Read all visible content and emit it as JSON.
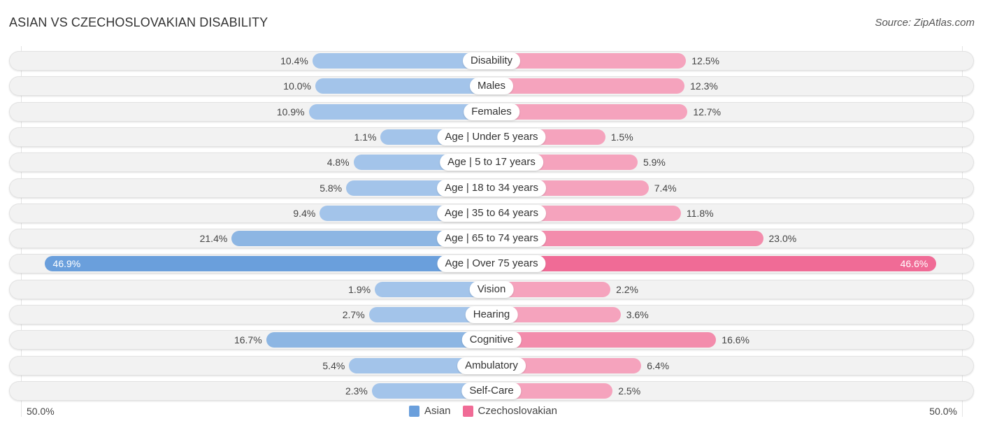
{
  "header": {
    "title": "ASIAN VS CZECHOSLOVAKIAN DISABILITY",
    "source": "Source: ZipAtlas.com"
  },
  "colors": {
    "asian": "#6a9fdc",
    "asian_light": "#a3c4ea",
    "czech": "#f06b96",
    "czech_light": "#f5a3bd"
  },
  "chart_data": {
    "type": "bar",
    "title": "ASIAN VS CZECHOSLOVAKIAN DISABILITY",
    "orientation": "horizontal-diverging",
    "categories": [
      "Disability",
      "Males",
      "Females",
      "Age | Under 5 years",
      "Age | 5 to 17 years",
      "Age | 18 to 34 years",
      "Age | 35 to 64 years",
      "Age | 65 to 74 years",
      "Age | Over 75 years",
      "Vision",
      "Hearing",
      "Cognitive",
      "Ambulatory",
      "Self-Care"
    ],
    "series": [
      {
        "name": "Asian",
        "side": "left",
        "values": [
          10.4,
          10.0,
          10.9,
          1.1,
          4.8,
          5.8,
          9.4,
          21.4,
          46.9,
          1.9,
          2.7,
          16.7,
          5.4,
          2.3
        ],
        "labels": [
          "10.4%",
          "10.0%",
          "10.9%",
          "1.1%",
          "4.8%",
          "5.8%",
          "9.4%",
          "21.4%",
          "46.9%",
          "1.9%",
          "2.7%",
          "16.7%",
          "5.4%",
          "2.3%"
        ]
      },
      {
        "name": "Czechoslovakian",
        "side": "right",
        "values": [
          12.5,
          12.3,
          12.7,
          1.5,
          5.9,
          7.4,
          11.8,
          23.0,
          46.6,
          2.2,
          3.6,
          16.6,
          6.4,
          2.5
        ],
        "labels": [
          "12.5%",
          "12.3%",
          "12.7%",
          "1.5%",
          "5.9%",
          "7.4%",
          "11.8%",
          "23.0%",
          "46.6%",
          "2.2%",
          "3.6%",
          "16.6%",
          "6.4%",
          "2.5%"
        ]
      }
    ],
    "xlim": [
      -50,
      50
    ],
    "axis_labels": {
      "left": "50.0%",
      "right": "50.0%"
    },
    "legend": {
      "position": "bottom-center",
      "entries": [
        "Asian",
        "Czechoslovakian"
      ]
    },
    "units": "%"
  }
}
